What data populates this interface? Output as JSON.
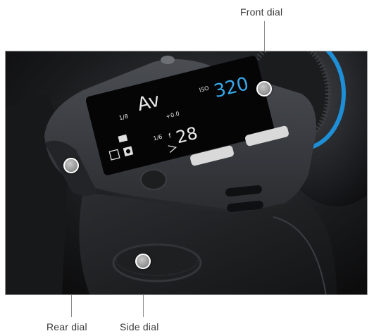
{
  "callouts": [
    {
      "id": "front",
      "label": "Front dial"
    },
    {
      "id": "rear",
      "label": "Rear dial"
    },
    {
      "id": "side",
      "label": "Side dial"
    }
  ],
  "lcd": {
    "mode": "Av",
    "iso": "320",
    "iso_prefix": "ISO",
    "aperture": "28",
    "aperture_prefix": "f",
    "shutter_small": "1/8",
    "ev_value": "+0.0",
    "small_number": "1/6"
  },
  "colors": {
    "accent_ring": "#1e8fd6",
    "iso_text": "#36a9ea",
    "body": "#2a2c2f",
    "marker": "#a6a6a6"
  }
}
